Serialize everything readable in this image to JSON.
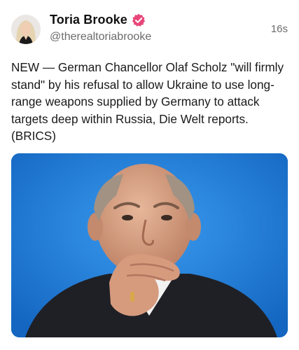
{
  "post": {
    "author": {
      "display_name": "Toria Brooke",
      "handle": "@therealtoriabrooke",
      "verified": true
    },
    "timestamp": "16s",
    "text": "NEW — German Chancellor Olaf Scholz \"will firmly stand\" by his refusal to allow Ukraine to use long-range weapons supplied by Germany to attack targets deep within Russia, Die Welt reports. (BRICS)",
    "media": {
      "type": "photo"
    }
  },
  "colors": {
    "verified_badge": "#e8477a",
    "photo_background": "#1e7fd6",
    "handle_gray": "#6b6b6b"
  },
  "icons": {
    "verified": "verified-badge-icon"
  }
}
